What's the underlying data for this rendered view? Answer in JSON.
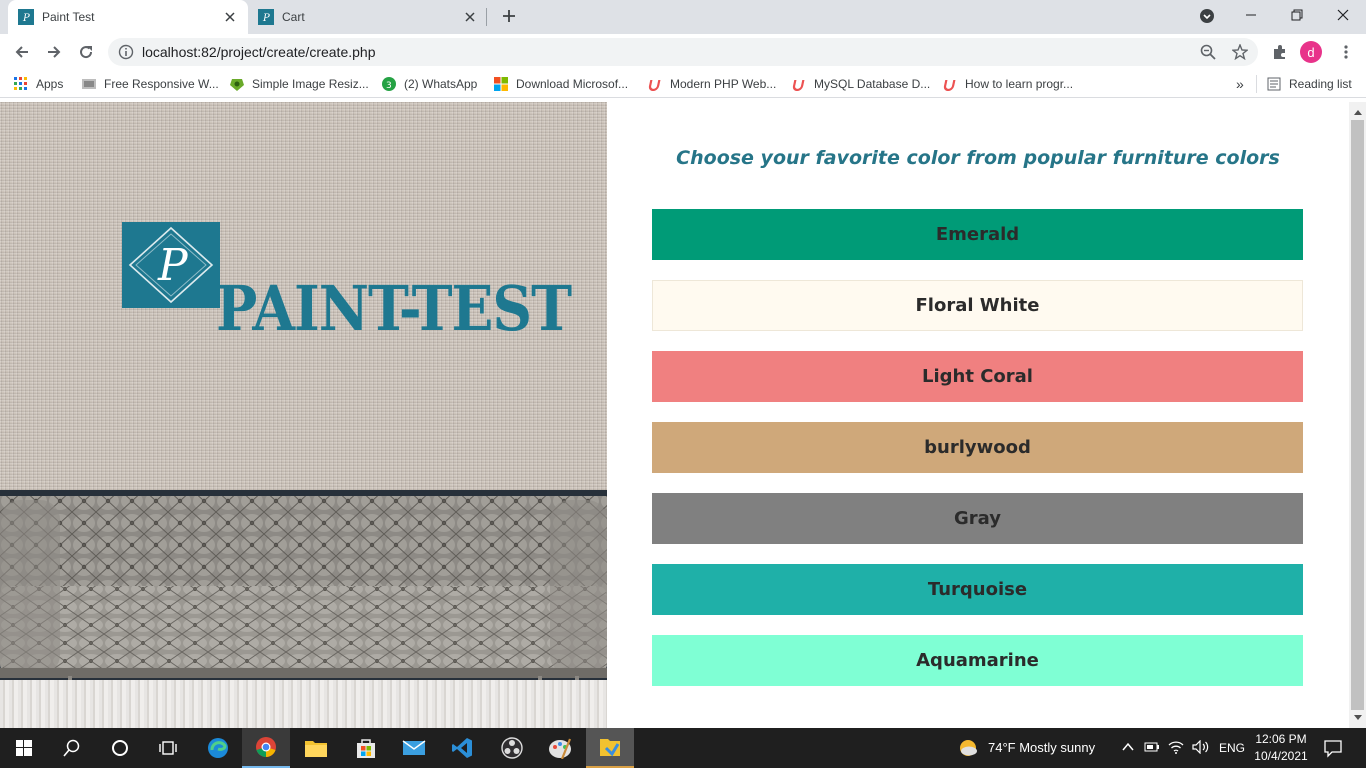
{
  "browser": {
    "tabs": [
      {
        "title": "Paint Test",
        "active": true
      },
      {
        "title": "Cart",
        "active": false
      }
    ],
    "url": "localhost:82/project/create/create.php",
    "profile_initial": "d"
  },
  "bookmarks": [
    {
      "label": "Apps",
      "icon": "apps-grid-icon"
    },
    {
      "label": "Free Responsive W...",
      "icon": "site-icon"
    },
    {
      "label": "Simple Image Resiz...",
      "icon": "image-resizer-icon"
    },
    {
      "label": "(2) WhatsApp",
      "icon": "whatsapp-icon",
      "badge": "3"
    },
    {
      "label": "Download Microsof...",
      "icon": "microsoft-icon"
    },
    {
      "label": "Modern PHP Web...",
      "icon": "udemy-icon"
    },
    {
      "label": "MySQL Database D...",
      "icon": "udemy-icon"
    },
    {
      "label": "How to learn progr...",
      "icon": "udemy-icon"
    }
  ],
  "bookmarks_overflow": "»",
  "reading_list": "Reading list",
  "page": {
    "logo_text": "PAINT-TEST",
    "logo_monogram": "P",
    "heading": "Choose your favorite color from popular furniture colors",
    "colors": [
      {
        "label": "Emerald",
        "color": "#009b77"
      },
      {
        "label": "Floral White",
        "color": "#fffaf0"
      },
      {
        "label": "Light Coral",
        "color": "#f08080"
      },
      {
        "label": "burlywood",
        "color": "#cfa87a"
      },
      {
        "label": "Gray",
        "color": "#808080"
      },
      {
        "label": "Turquoise",
        "color": "#1fb0a8"
      },
      {
        "label": "Aquamarine",
        "color": "#7fffd4"
      }
    ]
  },
  "taskbar": {
    "weather": "74°F  Mostly sunny",
    "language": "ENG",
    "time": "12:06 PM",
    "date": "10/4/2021"
  }
}
